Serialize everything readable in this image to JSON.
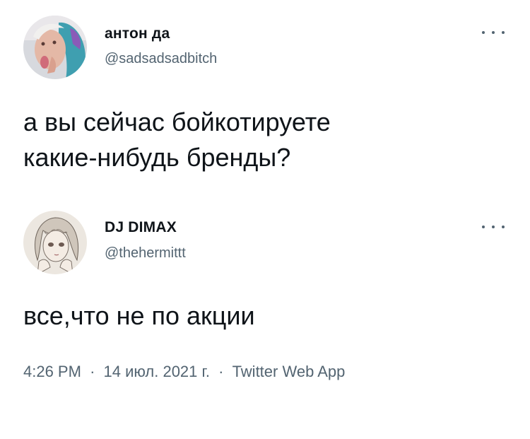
{
  "tweet1": {
    "display_name": "антон да",
    "handle": "@sadsadsadbitch",
    "text_line1": "а вы сейчас бойкотируете",
    "text_line2": "какие-нибудь бренды?",
    "more_icon": "more-horizontal-icon"
  },
  "tweet2": {
    "display_name": "DJ DIMAX",
    "handle": "@thehermittt",
    "text": "все,что не по акции",
    "more_icon": "more-horizontal-icon"
  },
  "meta": {
    "time": "4:26 PM",
    "separator": "·",
    "date": "14 июл. 2021 г.",
    "source": "Twitter Web App"
  }
}
